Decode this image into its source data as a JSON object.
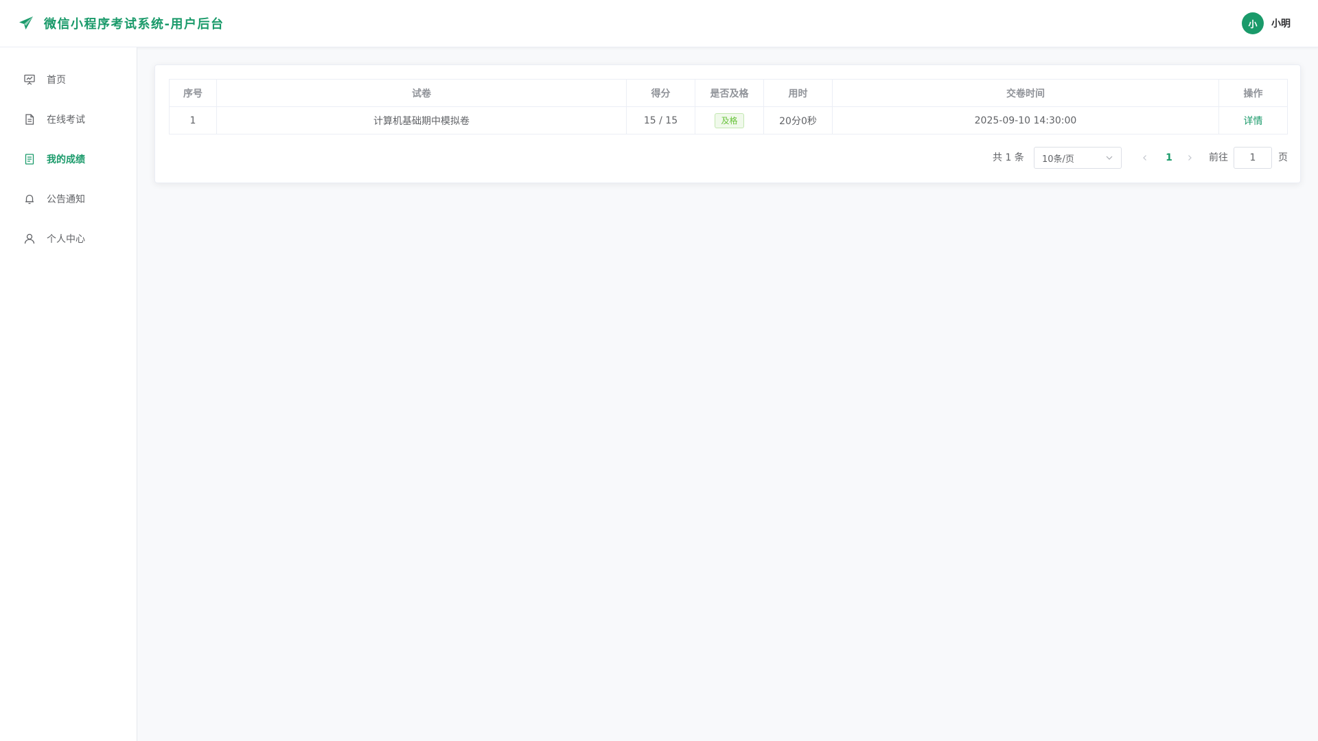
{
  "header": {
    "title": "微信小程序考试系统-用户后台",
    "brand_icon": "paper-plane-icon",
    "avatar_text": "小",
    "user_name": "小明",
    "accent_color": "#1a9a6a"
  },
  "sidebar": {
    "items": [
      {
        "label": "首页",
        "icon": "presentation-icon",
        "active": false
      },
      {
        "label": "在线考试",
        "icon": "document-icon",
        "active": false
      },
      {
        "label": "我的成绩",
        "icon": "report-icon",
        "active": true
      },
      {
        "label": "公告通知",
        "icon": "bell-icon",
        "active": false
      },
      {
        "label": "个人中心",
        "icon": "user-icon",
        "active": false
      }
    ]
  },
  "table": {
    "columns": [
      "序号",
      "试卷",
      "得分",
      "是否及格",
      "用时",
      "交卷时间",
      "操作"
    ],
    "rows": [
      {
        "index": "1",
        "paper": "计算机基础期中模拟卷",
        "score": "15 / 15",
        "pass": "及格",
        "duration": "20分0秒",
        "submit_time": "2025-09-10 14:30:00",
        "action": "详情"
      }
    ]
  },
  "pagination": {
    "total": "共 1 条",
    "page_size": "10条/页",
    "current_page": "1",
    "goto_label": "前往",
    "goto_value": "1",
    "page_suffix": "页"
  }
}
